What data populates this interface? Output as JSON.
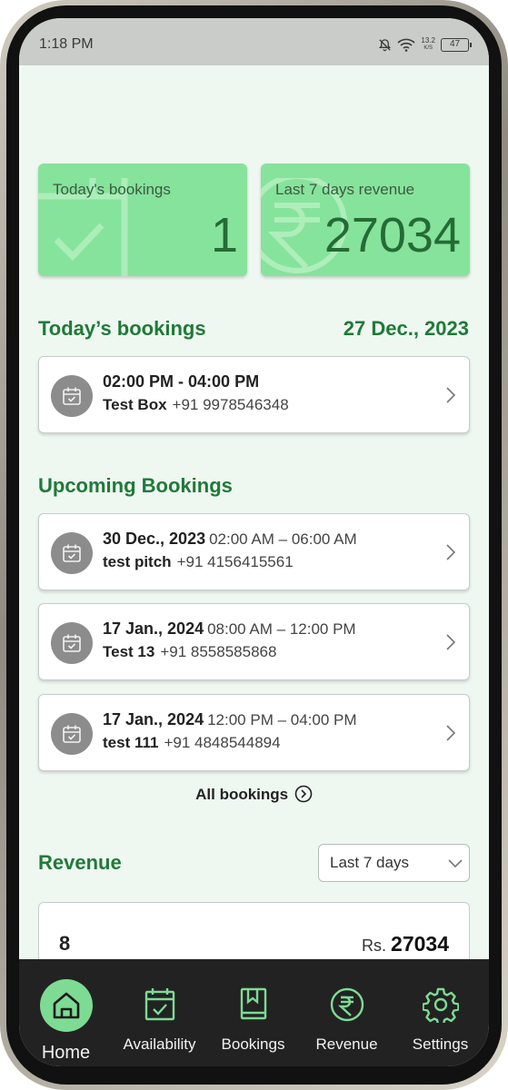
{
  "status_bar": {
    "time": "1:18 PM",
    "speed_top": "13.2",
    "speed_bottom": "K/S",
    "battery": "47"
  },
  "stats": {
    "bookings": {
      "label": "Today's bookings",
      "value": "1"
    },
    "revenue": {
      "label": "Last 7 days revenue",
      "value": "27034"
    }
  },
  "today": {
    "title": "Today’s bookings",
    "date": "27 Dec., 2023",
    "bookings": [
      {
        "time": "02:00 PM - 04:00 PM",
        "name": "Test Box",
        "phone": "+91 9978546348"
      }
    ]
  },
  "upcoming": {
    "title": "Upcoming Bookings",
    "bookings": [
      {
        "date": "30 Dec., 2023",
        "time": "02:00 AM – 06:00 AM",
        "name": "test pitch",
        "phone": "+91 4156415561"
      },
      {
        "date": "17 Jan., 2024",
        "time": "08:00 AM – 12:00 PM",
        "name": "Test 13",
        "phone": "+91 8558585868"
      },
      {
        "date": "17 Jan., 2024",
        "time": "12:00 PM – 04:00 PM",
        "name": "test 111",
        "phone": "+91 4848544894"
      }
    ],
    "all_link": "All bookings"
  },
  "revenue": {
    "title": "Revenue",
    "period_selected": "Last 7 days",
    "count": "8",
    "currency": "Rs.",
    "amount": "27034"
  },
  "nav": {
    "items": [
      {
        "label": "Home",
        "icon": "home-icon",
        "active": true
      },
      {
        "label": "Availability",
        "icon": "calendar-check-icon",
        "active": false
      },
      {
        "label": "Bookings",
        "icon": "book-icon",
        "active": false
      },
      {
        "label": "Revenue",
        "icon": "rupee-icon",
        "active": false
      },
      {
        "label": "Settings",
        "icon": "gear-icon",
        "active": false
      }
    ]
  },
  "colors": {
    "accent_green": "#1f7a38",
    "card_green": "#86e39c",
    "nav_bg": "#222222",
    "nav_active": "#7ddb93",
    "nav_icon": "#7ddb93"
  }
}
